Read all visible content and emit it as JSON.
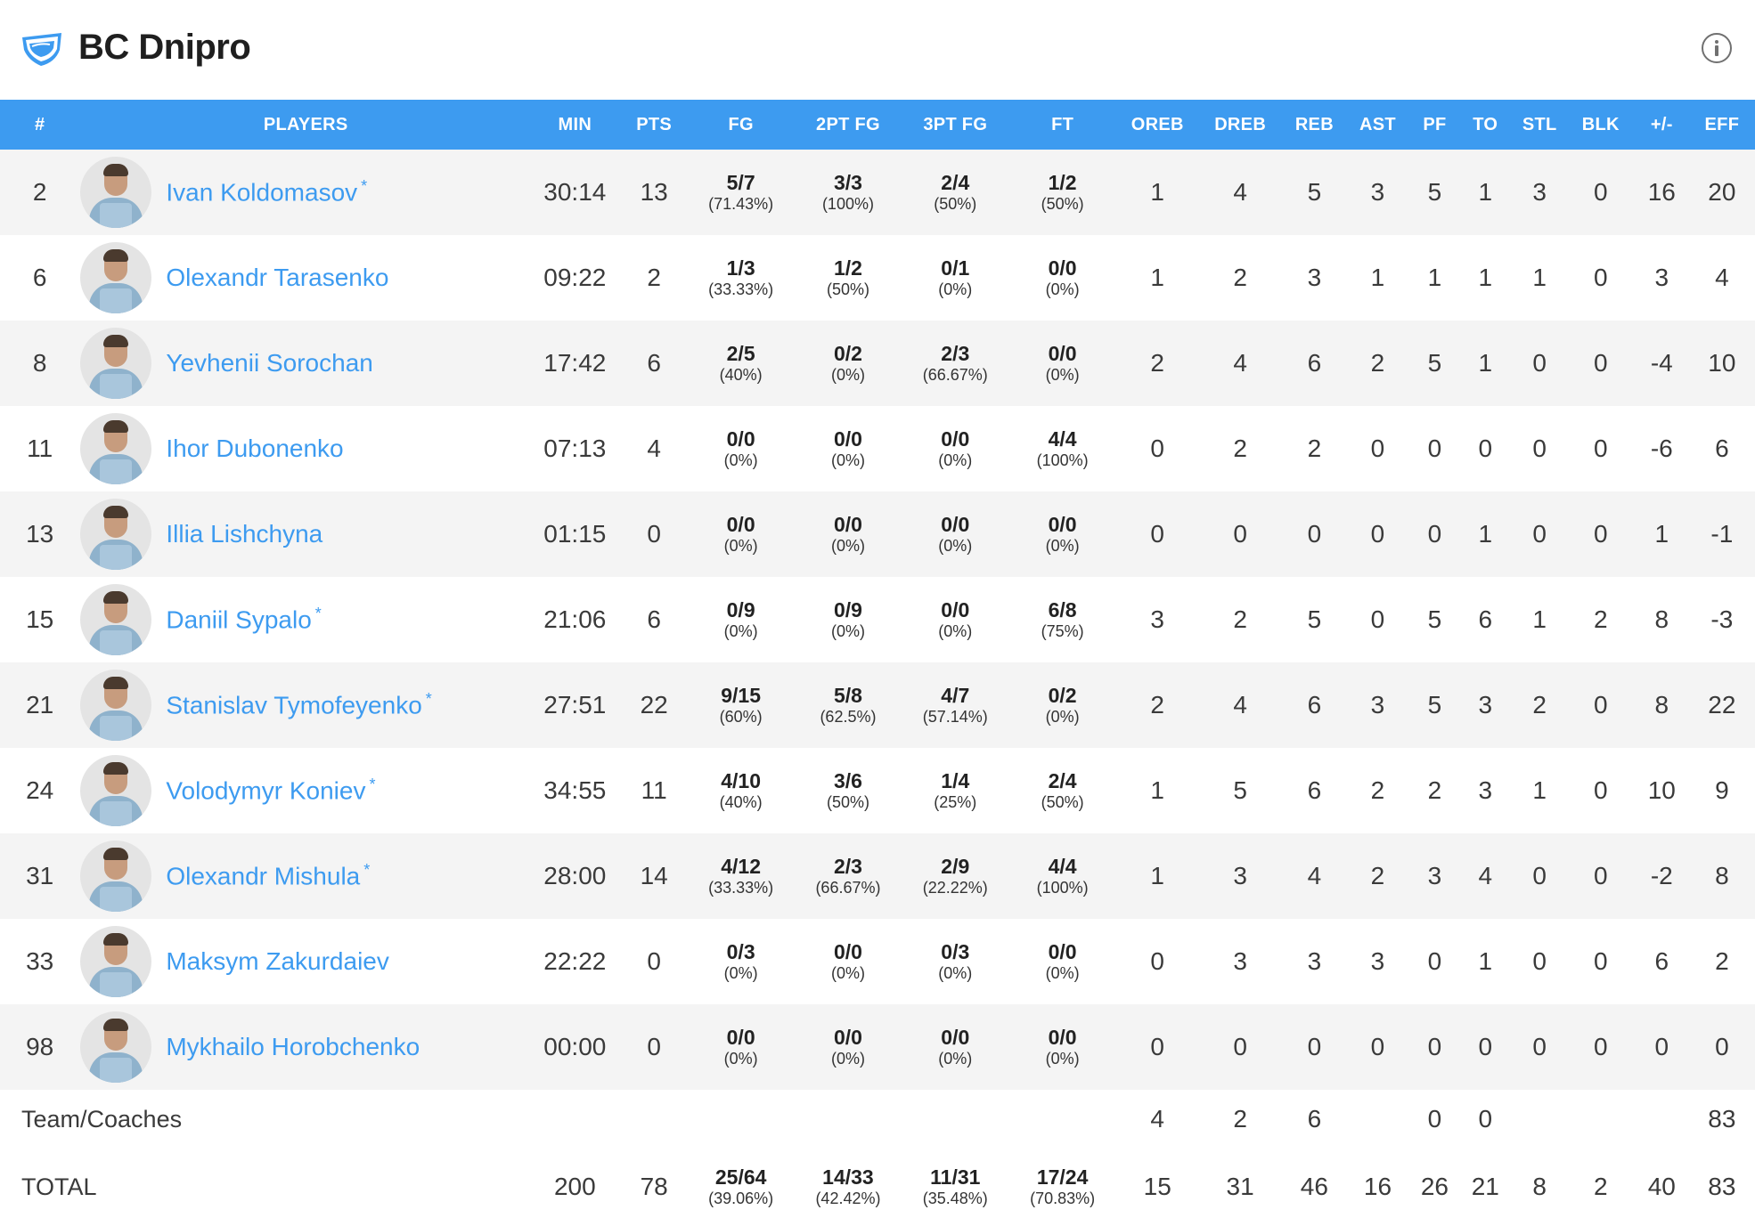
{
  "header": {
    "team_name": "BC Dnipro",
    "logo_icon": "dnipro-logo-icon",
    "info_icon": "info-icon"
  },
  "colors": {
    "accent": "#3d9bf0",
    "header_bg": "#3d9bf0",
    "row_alt": "#f4f4f4"
  },
  "columns": [
    "#",
    "PLAYERS",
    "MIN",
    "PTS",
    "FG",
    "2PT FG",
    "3PT FG",
    "FT",
    "OREB",
    "DREB",
    "REB",
    "AST",
    "PF",
    "TO",
    "STL",
    "BLK",
    "+/-",
    "EFF"
  ],
  "players": [
    {
      "no": "2",
      "name": "Ivan Koldomasov",
      "starter": true,
      "min": "30:14",
      "pts": "13",
      "fg": "5/7",
      "fg_pct": "(71.43%)",
      "fg2": "3/3",
      "fg2_pct": "(100%)",
      "fg3": "2/4",
      "fg3_pct": "(50%)",
      "ft": "1/2",
      "ft_pct": "(50%)",
      "oreb": "1",
      "dreb": "4",
      "reb": "5",
      "ast": "3",
      "pf": "5",
      "to": "1",
      "stl": "3",
      "blk": "0",
      "pm": "16",
      "eff": "20"
    },
    {
      "no": "6",
      "name": "Olexandr Tarasenko",
      "starter": false,
      "min": "09:22",
      "pts": "2",
      "fg": "1/3",
      "fg_pct": "(33.33%)",
      "fg2": "1/2",
      "fg2_pct": "(50%)",
      "fg3": "0/1",
      "fg3_pct": "(0%)",
      "ft": "0/0",
      "ft_pct": "(0%)",
      "oreb": "1",
      "dreb": "2",
      "reb": "3",
      "ast": "1",
      "pf": "1",
      "to": "1",
      "stl": "1",
      "blk": "0",
      "pm": "3",
      "eff": "4"
    },
    {
      "no": "8",
      "name": "Yevhenii Sorochan",
      "starter": false,
      "min": "17:42",
      "pts": "6",
      "fg": "2/5",
      "fg_pct": "(40%)",
      "fg2": "0/2",
      "fg2_pct": "(0%)",
      "fg3": "2/3",
      "fg3_pct": "(66.67%)",
      "ft": "0/0",
      "ft_pct": "(0%)",
      "oreb": "2",
      "dreb": "4",
      "reb": "6",
      "ast": "2",
      "pf": "5",
      "to": "1",
      "stl": "0",
      "blk": "0",
      "pm": "-4",
      "eff": "10"
    },
    {
      "no": "11",
      "name": "Ihor Dubonenko",
      "starter": false,
      "min": "07:13",
      "pts": "4",
      "fg": "0/0",
      "fg_pct": "(0%)",
      "fg2": "0/0",
      "fg2_pct": "(0%)",
      "fg3": "0/0",
      "fg3_pct": "(0%)",
      "ft": "4/4",
      "ft_pct": "(100%)",
      "oreb": "0",
      "dreb": "2",
      "reb": "2",
      "ast": "0",
      "pf": "0",
      "to": "0",
      "stl": "0",
      "blk": "0",
      "pm": "-6",
      "eff": "6"
    },
    {
      "no": "13",
      "name": "Illia Lishchyna",
      "starter": false,
      "min": "01:15",
      "pts": "0",
      "fg": "0/0",
      "fg_pct": "(0%)",
      "fg2": "0/0",
      "fg2_pct": "(0%)",
      "fg3": "0/0",
      "fg3_pct": "(0%)",
      "ft": "0/0",
      "ft_pct": "(0%)",
      "oreb": "0",
      "dreb": "0",
      "reb": "0",
      "ast": "0",
      "pf": "0",
      "to": "1",
      "stl": "0",
      "blk": "0",
      "pm": "1",
      "eff": "-1"
    },
    {
      "no": "15",
      "name": "Daniil Sypalo",
      "starter": true,
      "min": "21:06",
      "pts": "6",
      "fg": "0/9",
      "fg_pct": "(0%)",
      "fg2": "0/9",
      "fg2_pct": "(0%)",
      "fg3": "0/0",
      "fg3_pct": "(0%)",
      "ft": "6/8",
      "ft_pct": "(75%)",
      "oreb": "3",
      "dreb": "2",
      "reb": "5",
      "ast": "0",
      "pf": "5",
      "to": "6",
      "stl": "1",
      "blk": "2",
      "pm": "8",
      "eff": "-3"
    },
    {
      "no": "21",
      "name": "Stanislav Tymofeyenko",
      "starter": true,
      "min": "27:51",
      "pts": "22",
      "fg": "9/15",
      "fg_pct": "(60%)",
      "fg2": "5/8",
      "fg2_pct": "(62.5%)",
      "fg3": "4/7",
      "fg3_pct": "(57.14%)",
      "ft": "0/2",
      "ft_pct": "(0%)",
      "oreb": "2",
      "dreb": "4",
      "reb": "6",
      "ast": "3",
      "pf": "5",
      "to": "3",
      "stl": "2",
      "blk": "0",
      "pm": "8",
      "eff": "22"
    },
    {
      "no": "24",
      "name": "Volodymyr Koniev",
      "starter": true,
      "min": "34:55",
      "pts": "11",
      "fg": "4/10",
      "fg_pct": "(40%)",
      "fg2": "3/6",
      "fg2_pct": "(50%)",
      "fg3": "1/4",
      "fg3_pct": "(25%)",
      "ft": "2/4",
      "ft_pct": "(50%)",
      "oreb": "1",
      "dreb": "5",
      "reb": "6",
      "ast": "2",
      "pf": "2",
      "to": "3",
      "stl": "1",
      "blk": "0",
      "pm": "10",
      "eff": "9"
    },
    {
      "no": "31",
      "name": "Olexandr Mishula",
      "starter": true,
      "min": "28:00",
      "pts": "14",
      "fg": "4/12",
      "fg_pct": "(33.33%)",
      "fg2": "2/3",
      "fg2_pct": "(66.67%)",
      "fg3": "2/9",
      "fg3_pct": "(22.22%)",
      "ft": "4/4",
      "ft_pct": "(100%)",
      "oreb": "1",
      "dreb": "3",
      "reb": "4",
      "ast": "2",
      "pf": "3",
      "to": "4",
      "stl": "0",
      "blk": "0",
      "pm": "-2",
      "eff": "8"
    },
    {
      "no": "33",
      "name": "Maksym Zakurdaiev",
      "starter": false,
      "min": "22:22",
      "pts": "0",
      "fg": "0/3",
      "fg_pct": "(0%)",
      "fg2": "0/0",
      "fg2_pct": "(0%)",
      "fg3": "0/3",
      "fg3_pct": "(0%)",
      "ft": "0/0",
      "ft_pct": "(0%)",
      "oreb": "0",
      "dreb": "3",
      "reb": "3",
      "ast": "3",
      "pf": "0",
      "to": "1",
      "stl": "0",
      "blk": "0",
      "pm": "6",
      "eff": "2"
    },
    {
      "no": "98",
      "name": "Mykhailo Horobchenko",
      "starter": false,
      "min": "00:00",
      "pts": "0",
      "fg": "0/0",
      "fg_pct": "(0%)",
      "fg2": "0/0",
      "fg2_pct": "(0%)",
      "fg3": "0/0",
      "fg3_pct": "(0%)",
      "ft": "0/0",
      "ft_pct": "(0%)",
      "oreb": "0",
      "dreb": "0",
      "reb": "0",
      "ast": "0",
      "pf": "0",
      "to": "0",
      "stl": "0",
      "blk": "0",
      "pm": "0",
      "eff": "0"
    }
  ],
  "team_coaches": {
    "label": "Team/Coaches",
    "oreb": "4",
    "dreb": "2",
    "reb": "6",
    "pf": "0",
    "to": "0",
    "eff": "83"
  },
  "total": {
    "label": "TOTAL",
    "min": "200",
    "pts": "78",
    "fg": "25/64",
    "fg_pct": "(39.06%)",
    "fg2": "14/33",
    "fg2_pct": "(42.42%)",
    "fg3": "11/31",
    "fg3_pct": "(35.48%)",
    "ft": "17/24",
    "ft_pct": "(70.83%)",
    "oreb": "15",
    "dreb": "31",
    "reb": "46",
    "ast": "16",
    "pf": "26",
    "to": "21",
    "stl": "8",
    "blk": "2",
    "pm": "40",
    "eff": "83"
  }
}
